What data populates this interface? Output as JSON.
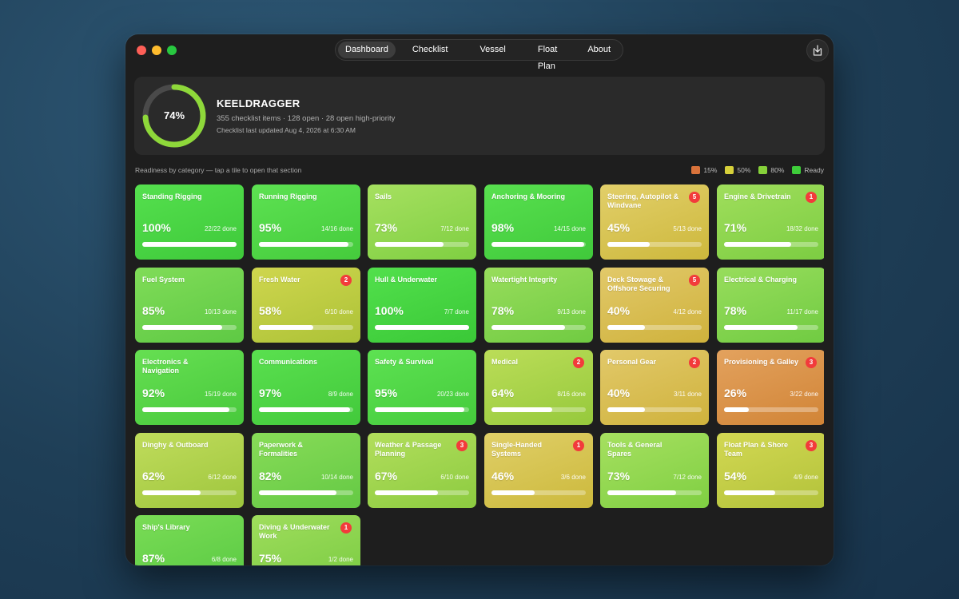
{
  "nav": {
    "tabs": [
      {
        "label": "Dashboard",
        "active": true
      },
      {
        "label": "Checklist",
        "active": false
      },
      {
        "label": "Vessel",
        "active": false
      },
      {
        "label": "Float Plan",
        "active": false
      },
      {
        "label": "About",
        "active": false
      }
    ],
    "export_icon": "export-icon"
  },
  "summary": {
    "readiness_percent": "74%",
    "readiness_fraction": 0.74,
    "vessel_name": "KEELDRAGGER",
    "stats": "355 checklist items · 128 open · 28 open high-priority",
    "updated": "Checklist last updated Aug 4, 2026 at 6:30 AM",
    "ring_color": "#8ed83a",
    "ring_track_color": "#4a4a4a"
  },
  "readiness_hint": "Readiness by category — tap a tile to open that section",
  "legend": [
    {
      "label": "15%",
      "color": "#d9733b"
    },
    {
      "label": "50%",
      "color": "#d6d03a"
    },
    {
      "label": "80%",
      "color": "#86d13a"
    },
    {
      "label": "Ready",
      "color": "#3ecd3a"
    }
  ],
  "tiles": [
    {
      "name": "Standing Rigging",
      "pct": "100%",
      "progress": 1.0,
      "done": "22/22 done",
      "badge": "",
      "c1": "#55e04e",
      "c2": "#3ec93a"
    },
    {
      "name": "Running Rigging",
      "pct": "95%",
      "progress": 0.95,
      "done": "14/16 done",
      "badge": "",
      "c1": "#5de252",
      "c2": "#45cb3c"
    },
    {
      "name": "Sails",
      "pct": "73%",
      "progress": 0.73,
      "done": "7/12 done",
      "badge": "",
      "c1": "#a6e060",
      "c2": "#7fcf42"
    },
    {
      "name": "Anchoring & Mooring",
      "pct": "98%",
      "progress": 0.98,
      "done": "14/15 done",
      "badge": "",
      "c1": "#58e04f",
      "c2": "#40c93b"
    },
    {
      "name": "Steering, Autopilot & Windvane",
      "pct": "45%",
      "progress": 0.45,
      "done": "5/13 done",
      "badge": "5",
      "c1": "#e2cf6a",
      "c2": "#cdb83c"
    },
    {
      "name": "Engine & Drivetrain",
      "pct": "71%",
      "progress": 0.71,
      "done": "18/32 done",
      "badge": "1",
      "c1": "#a0de5c",
      "c2": "#7ccd42"
    },
    {
      "name": "Fuel System",
      "pct": "85%",
      "progress": 0.85,
      "done": "10/13 done",
      "badge": "",
      "c1": "#80dc58",
      "c2": "#5ec944"
    },
    {
      "name": "Fresh Water",
      "pct": "58%",
      "progress": 0.58,
      "done": "6/10 done",
      "badge": "2",
      "c1": "#cfd64e",
      "c2": "#acc237"
    },
    {
      "name": "Hull & Underwater",
      "pct": "100%",
      "progress": 1.0,
      "done": "7/7 done",
      "badge": "",
      "c1": "#52e04c",
      "c2": "#3ac837"
    },
    {
      "name": "Watertight Integrity",
      "pct": "78%",
      "progress": 0.78,
      "done": "9/13 done",
      "badge": "",
      "c1": "#98dd5c",
      "c2": "#70cb42"
    },
    {
      "name": "Deck Stowage & Offshore Securing",
      "pct": "40%",
      "progress": 0.4,
      "done": "4/12 done",
      "badge": "5",
      "c1": "#e2c96a",
      "c2": "#cfb23c"
    },
    {
      "name": "Electrical & Charging",
      "pct": "78%",
      "progress": 0.78,
      "done": "11/17 done",
      "badge": "",
      "c1": "#98dd5c",
      "c2": "#70cb42"
    },
    {
      "name": "Electronics & Navigation",
      "pct": "92%",
      "progress": 0.92,
      "done": "15/19 done",
      "badge": "",
      "c1": "#66df52",
      "c2": "#48c93c"
    },
    {
      "name": "Communications",
      "pct": "97%",
      "progress": 0.97,
      "done": "8/9 done",
      "badge": "",
      "c1": "#5ae04f",
      "c2": "#42c93b"
    },
    {
      "name": "Safety & Survival",
      "pct": "95%",
      "progress": 0.95,
      "done": "20/23 done",
      "badge": "",
      "c1": "#5de252",
      "c2": "#45cb3c"
    },
    {
      "name": "Medical",
      "pct": "64%",
      "progress": 0.64,
      "done": "8/16 done",
      "badge": "2",
      "c1": "#bbdd58",
      "c2": "#96c93c"
    },
    {
      "name": "Personal Gear",
      "pct": "40%",
      "progress": 0.4,
      "done": "3/11 done",
      "badge": "2",
      "c1": "#e2c96a",
      "c2": "#cfb23c"
    },
    {
      "name": "Provisioning & Galley",
      "pct": "26%",
      "progress": 0.26,
      "done": "3/22 done",
      "badge": "3",
      "c1": "#e3a25e",
      "c2": "#d18436"
    },
    {
      "name": "Dinghy & Outboard",
      "pct": "62%",
      "progress": 0.62,
      "done": "6/12 done",
      "badge": "",
      "c1": "#c0dc5c",
      "c2": "#9ec63d"
    },
    {
      "name": "Paperwork & Formalities",
      "pct": "82%",
      "progress": 0.82,
      "done": "10/14 done",
      "badge": "",
      "c1": "#88dc58",
      "c2": "#64c944"
    },
    {
      "name": "Weather & Passage Planning",
      "pct": "67%",
      "progress": 0.67,
      "done": "6/10 done",
      "badge": "3",
      "c1": "#b2de5c",
      "c2": "#8ccb40"
    },
    {
      "name": "Single-Handed Systems",
      "pct": "46%",
      "progress": 0.46,
      "done": "3/6 done",
      "badge": "1",
      "c1": "#e0cf68",
      "c2": "#ccb93c"
    },
    {
      "name": "Tools & General Spares",
      "pct": "73%",
      "progress": 0.73,
      "done": "7/12 done",
      "badge": "",
      "c1": "#a6e060",
      "c2": "#7fcf42"
    },
    {
      "name": "Float Plan & Shore Team",
      "pct": "54%",
      "progress": 0.54,
      "done": "4/9 done",
      "badge": "3",
      "c1": "#d3d853",
      "c2": "#b2c23a"
    },
    {
      "name": "Ship's Library",
      "pct": "87%",
      "progress": 0.87,
      "done": "6/8 done",
      "badge": "",
      "c1": "#7adc56",
      "c2": "#58c942"
    },
    {
      "name": "Diving & Underwater Work",
      "pct": "75%",
      "progress": 0.75,
      "done": "1/2 done",
      "badge": "1",
      "c1": "#9fdd5c",
      "c2": "#79cb42"
    }
  ]
}
